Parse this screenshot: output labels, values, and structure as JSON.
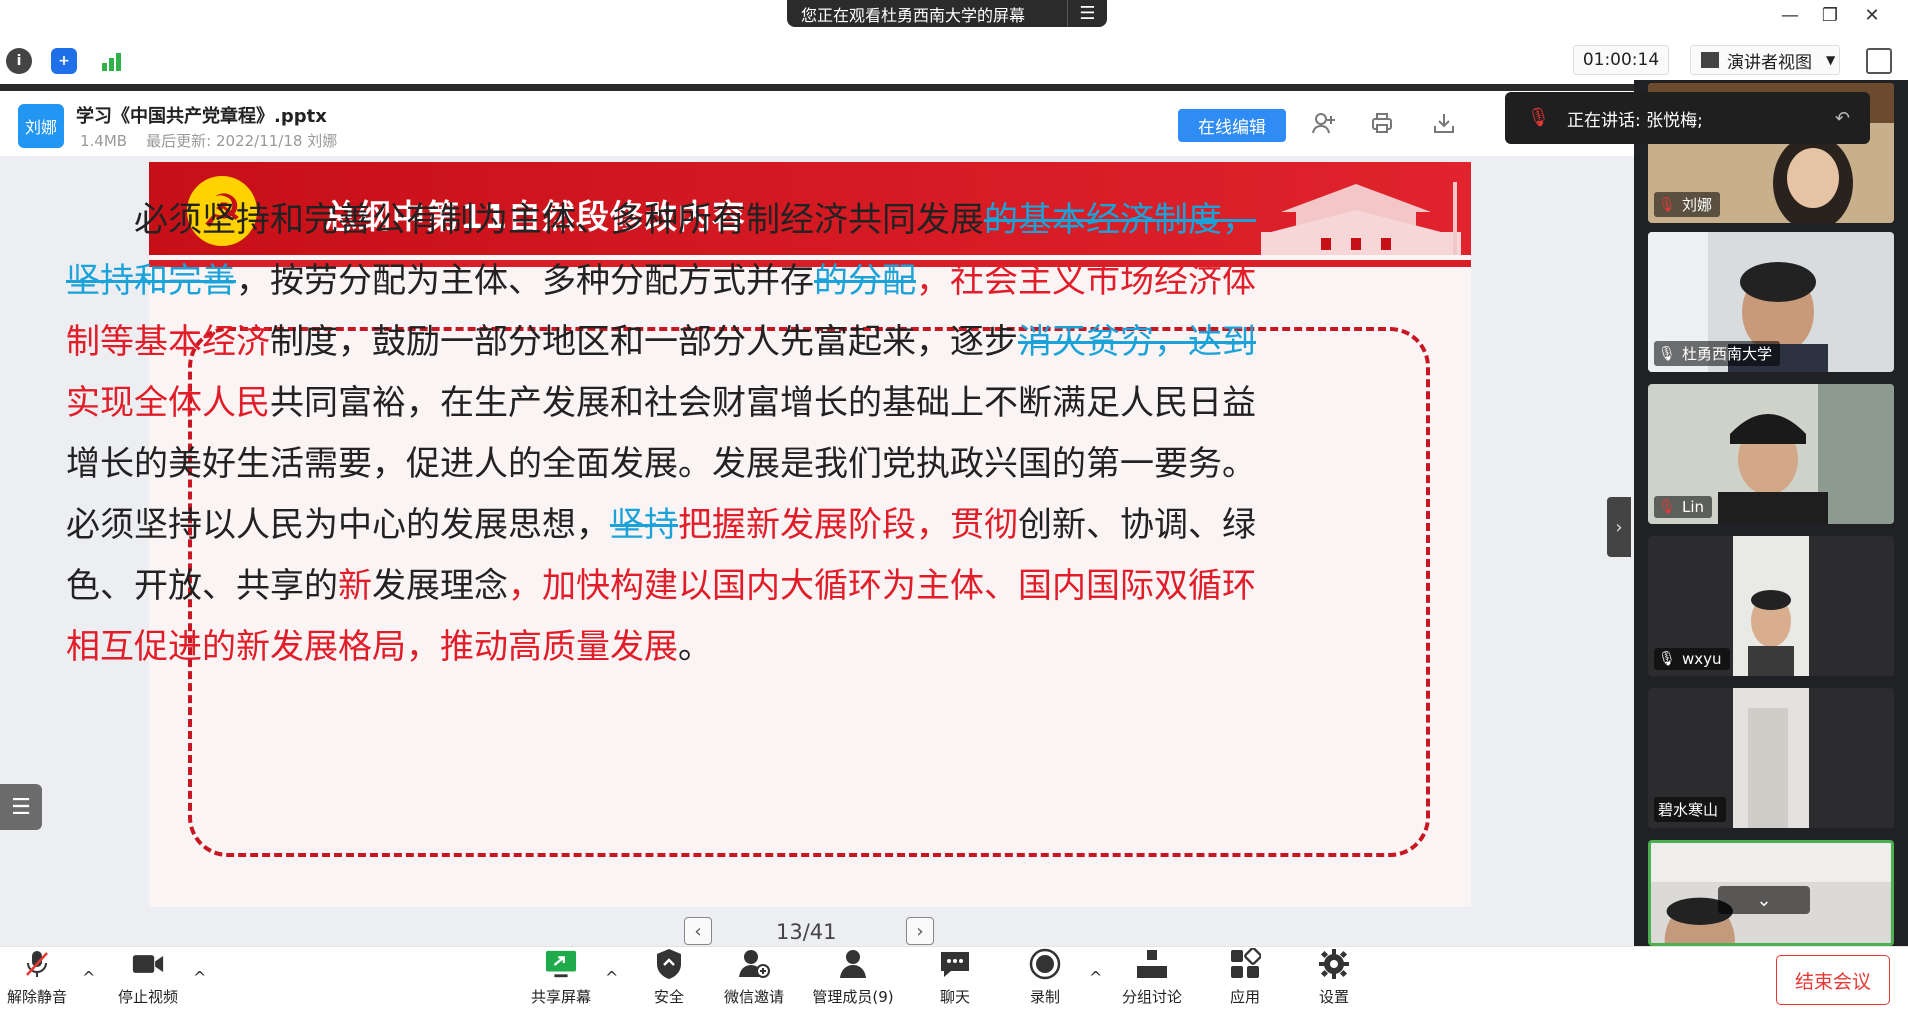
{
  "window": {
    "share_notice": "您正在观看杜勇西南大学的屏幕",
    "controls": {
      "minimize": "—",
      "restore": "❐",
      "close": "✕"
    }
  },
  "topbar": {
    "timer": "01:00:14",
    "view_mode": "演讲者视图",
    "status_icons": [
      "info-icon",
      "shield-icon",
      "signal-icon"
    ]
  },
  "file": {
    "avatar": "刘娜",
    "name": "学习《中国共产党章程》.pptx",
    "meta": "1.4MB    最后更新: 2022/11/18 刘娜",
    "edit_label": "在线编辑"
  },
  "slide": {
    "title": "总纲中第11自然段修改内容",
    "runs": [
      {
        "t": "必须坚持和完善公有制为主体、多种所有制经济共同发展",
        "c": "n"
      },
      {
        "t": "的基本经济制度，坚持和完善",
        "c": "b"
      },
      {
        "t": "，按劳分配为主体、多种分配方式并存",
        "c": "n"
      },
      {
        "t": "的分配",
        "c": "b"
      },
      {
        "t": "，社会主义市场经济体制等基本经济",
        "c": "r"
      },
      {
        "t": "制度，鼓励一部分地区和一部分人先富起来，逐步",
        "c": "n"
      },
      {
        "t": "消灭贫穷，达到",
        "c": "b"
      },
      {
        "t": "实现全体人民",
        "c": "r"
      },
      {
        "t": "共同富裕，在生产发展和社会财富增长的基础上不断满足人民日益增长的美好生活需要，促进人的全面发展。发展是我们党执政兴国的第一要务。必须坚持以人民为中心的发展思想，",
        "c": "n"
      },
      {
        "t": "坚持",
        "c": "b"
      },
      {
        "t": "把握新发展阶段，贯彻",
        "c": "r"
      },
      {
        "t": "创新、协调、绿色、开放、共享的",
        "c": "n"
      },
      {
        "t": "新",
        "c": "r"
      },
      {
        "t": "发展理念",
        "c": "n"
      },
      {
        "t": "，加快构建以国内大循环为主体、国内国际双循环相互促进的新发展格局，推动高质量发展",
        "c": "r"
      },
      {
        "t": "。",
        "c": "n"
      }
    ],
    "page": "13/41"
  },
  "speaking": {
    "label": "正在讲话: 张悦梅;"
  },
  "participants": [
    {
      "name": "刘娜",
      "muted": true
    },
    {
      "name": "杜勇西南大学",
      "muted": false
    },
    {
      "name": "Lin",
      "muted": true
    },
    {
      "name": "wxyu",
      "muted": false
    },
    {
      "name": "碧水寒山",
      "muted": null
    },
    {
      "name": "",
      "muted": null
    }
  ],
  "toolbar": {
    "unmute": "解除静音",
    "stop_video": "停止视频",
    "share": "共享屏幕",
    "security": "安全",
    "invite": "微信邀请",
    "members": "管理成员(9)",
    "chat": "聊天",
    "record": "录制",
    "breakout": "分组讨论",
    "apps": "应用",
    "settings": "设置",
    "end": "结束会议"
  },
  "colors": {
    "accent": "#2f8cf4",
    "banner_red": "#d91e27",
    "revised_red": "#e11d29",
    "deleted_blue": "#1ba3d9",
    "end_red": "#e53935"
  }
}
